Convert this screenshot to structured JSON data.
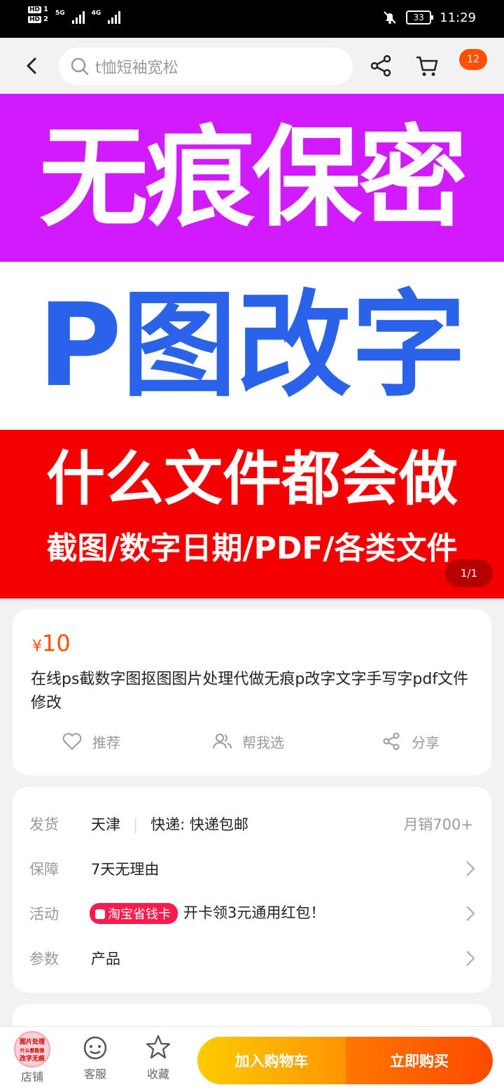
{
  "status_bar": {
    "sim1": "HD",
    "sim1_num": "1",
    "sim2": "HD",
    "sim2_num": "2",
    "net1": "5G",
    "net2": "4G",
    "battery": "33",
    "time": "11:29"
  },
  "header": {
    "search_placeholder": "t恤短袖宽松",
    "cart_badge": "12"
  },
  "banner": {
    "line1": "无痕保密",
    "line2": "P图改字",
    "line3": "什么文件都会做",
    "line4": "截图/数字日期/PDF/各类文件",
    "pager": "1/1",
    "colors": {
      "top": "#d21aff",
      "middle": "#ffffff",
      "bottom": "#f40000",
      "blue_text": "#2a62ea"
    }
  },
  "product": {
    "currency": "¥",
    "price": "10",
    "title": "在线ps截数字图抠图图片处理代做无痕p改字文字手写字pdf文件修改",
    "actions": {
      "recommend": "推荐",
      "help_choose": "帮我选",
      "share": "分享"
    }
  },
  "details": {
    "shipping": {
      "label": "发货",
      "origin": "天津",
      "express": "快递: 快递包邮",
      "sales": "月销700+"
    },
    "guarantee": {
      "label": "保障",
      "value": "7天无理由"
    },
    "activity": {
      "label": "活动",
      "tag": "淘宝省钱卡",
      "value": "开卡领3元通用红包！"
    },
    "params": {
      "label": "参数",
      "value": "产品"
    }
  },
  "bottom_bar": {
    "shop": "店铺",
    "shop_logo_lines": [
      "图片处理",
      "什么都能做",
      "改字无痕"
    ],
    "service": "客服",
    "favorite": "收藏",
    "add_to_cart": "加入购物车",
    "buy_now": "立即购买"
  },
  "accent_color": "#ff5000"
}
